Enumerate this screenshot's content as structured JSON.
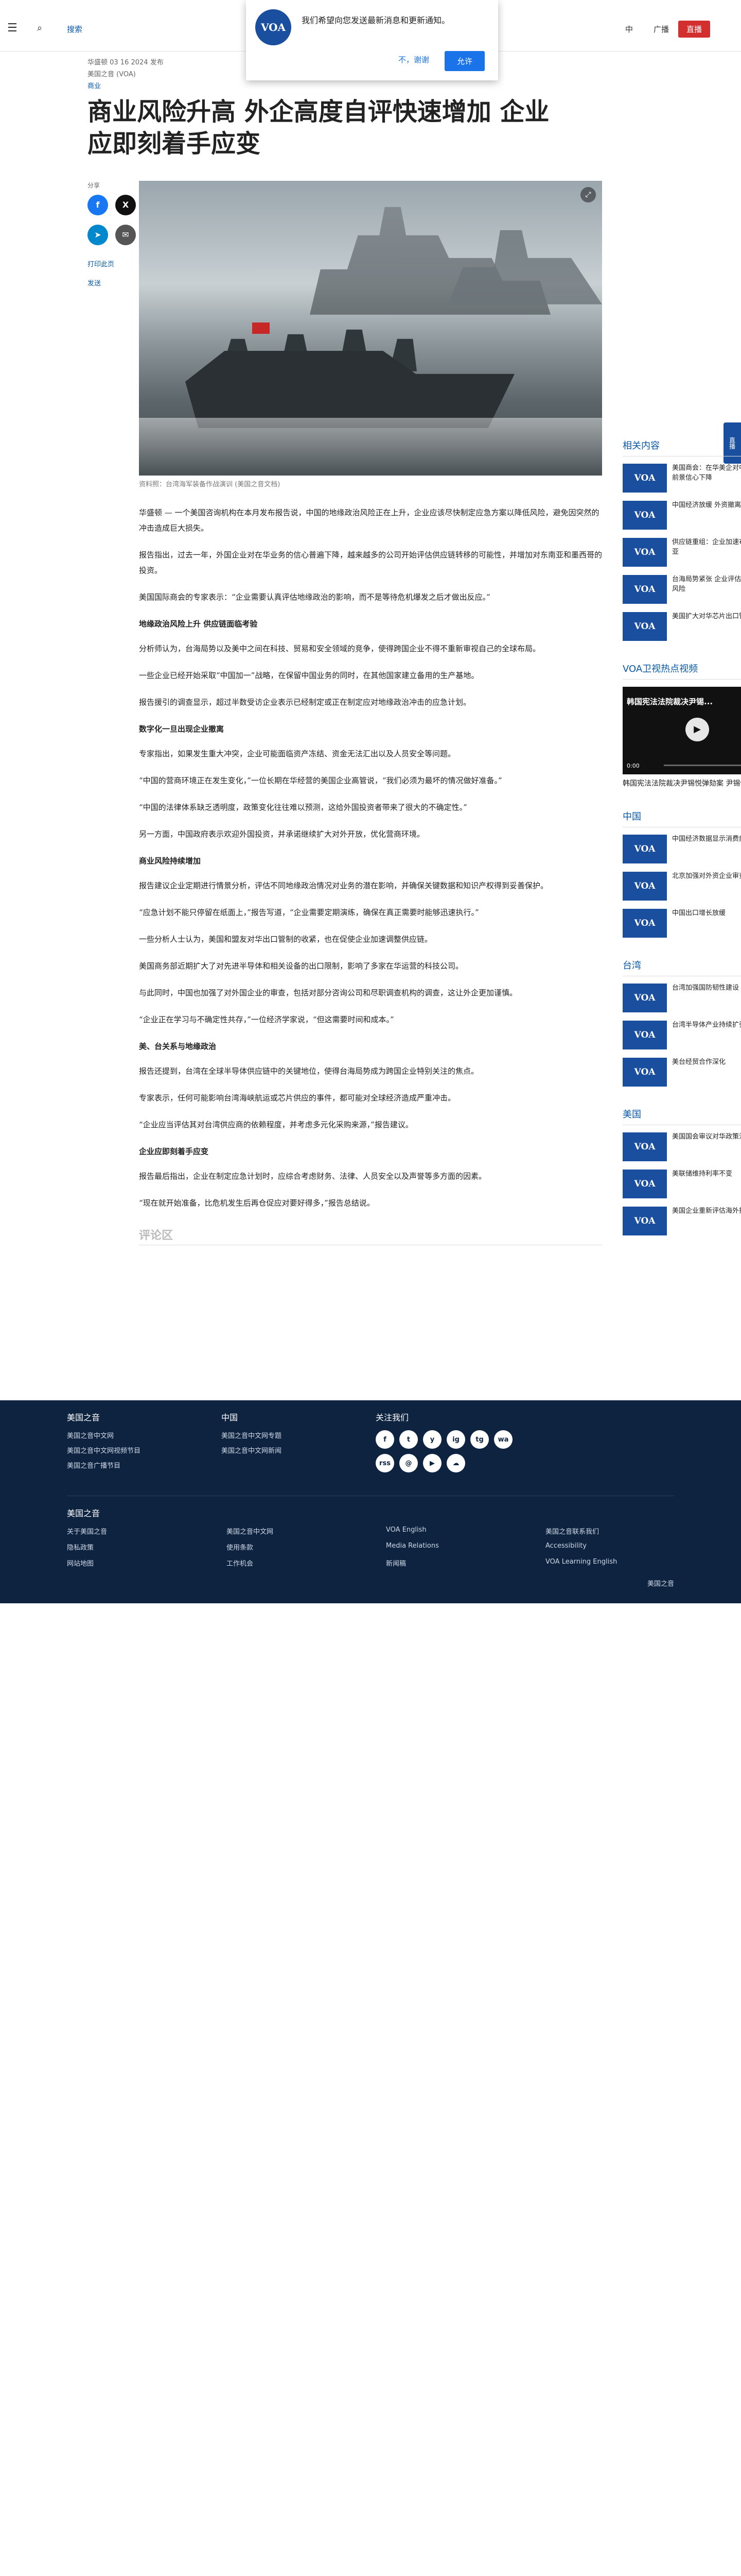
{
  "header": {
    "search_label": "搜索",
    "lang": "中",
    "radio": "广播",
    "live": "直播"
  },
  "notify": {
    "logo": "VOA",
    "text": "我们希望向您发送最新消息和更新通知。",
    "no": "不，谢谢",
    "yes": "允许"
  },
  "meta": {
    "date": "华盛顿 03 16 2024 发布",
    "author": "美国之音 (VOA)",
    "category": "商业"
  },
  "title": "商业风险升高 外企高度自评快速增加 企业应即刻着手应变",
  "share": {
    "label": "分享",
    "print": "打印此页",
    "email": "发送"
  },
  "hero": {
    "caption": "资料照：台湾海军装备作战演训 (美国之音文档)"
  },
  "body": [
    {
      "type": "p",
      "text": "华盛顿 — 一个美国咨询机构在本月发布报告说，中国的地缘政治风险正在上升，企业应该尽快制定应急方案以降低风险，避免因突然的冲击造成巨大损失。"
    },
    {
      "type": "p",
      "text": "报告指出，过去一年，外国企业对在华业务的信心普遍下降，越来越多的公司开始评估供应链转移的可能性，并增加对东南亚和墨西哥的投资。"
    },
    {
      "type": "p",
      "text": "美国国际商会的专家表示：“企业需要认真评估地缘政治的影响，而不是等待危机爆发之后才做出反应。”"
    },
    {
      "type": "h3",
      "text": "地缘政治风险上升 供应链面临考验"
    },
    {
      "type": "p",
      "text": "分析师认为，台海局势以及美中之间在科技、贸易和安全领域的竞争，使得跨国企业不得不重新审视自己的全球布局。"
    },
    {
      "type": "p",
      "text": "一些企业已经开始采取“中国加一”战略，在保留中国业务的同时，在其他国家建立备用的生产基地。"
    },
    {
      "type": "p",
      "text": "报告援引的调查显示，超过半数受访企业表示已经制定或正在制定应对地缘政治冲击的应急计划。"
    },
    {
      "type": "h3",
      "text": "数字化一旦出现企业撤离"
    },
    {
      "type": "p",
      "text": "专家指出，如果发生重大冲突，企业可能面临资产冻结、资金无法汇出以及人员安全等问题。"
    },
    {
      "type": "p",
      "text": "“中国的营商环境正在发生变化，”一位长期在华经营的美国企业高管说，“我们必须为最坏的情况做好准备。”"
    },
    {
      "type": "p",
      "text": "“中国的法律体系缺乏透明度，政策变化往往难以预测，这给外国投资者带来了很大的不确定性。”"
    },
    {
      "type": "p",
      "text": "另一方面，中国政府表示欢迎外国投资，并承诺继续扩大对外开放，优化营商环境。"
    },
    {
      "type": "h3",
      "text": "商业风险持续增加"
    },
    {
      "type": "p",
      "text": "报告建议企业定期进行情景分析，评估不同地缘政治情况对业务的潜在影响，并确保关键数据和知识产权得到妥善保护。"
    },
    {
      "type": "p",
      "text": "“应急计划不能只停留在纸面上，”报告写道，“企业需要定期演练，确保在真正需要时能够迅速执行。”"
    },
    {
      "type": "p",
      "text": "一些分析人士认为，美国和盟友对华出口管制的收紧，也在促使企业加速调整供应链。"
    },
    {
      "type": "p",
      "text": "美国商务部近期扩大了对先进半导体和相关设备的出口限制，影响了多家在华运营的科技公司。"
    },
    {
      "type": "p",
      "text": "与此同时，中国也加强了对外国企业的审查，包括对部分咨询公司和尽职调查机构的调查，这让外企更加谨慎。"
    },
    {
      "type": "p",
      "text": "“企业正在学习与不确定性共存，”一位经济学家说，“但这需要时间和成本。”"
    },
    {
      "type": "h3",
      "text": "美、台关系与地缘政治"
    },
    {
      "type": "p",
      "text": "报告还提到，台湾在全球半导体供应链中的关键地位，使得台海局势成为跨国企业特别关注的焦点。"
    },
    {
      "type": "p",
      "text": "专家表示，任何可能影响台湾海峡航运或芯片供应的事件，都可能对全球经济造成严重冲击。"
    },
    {
      "type": "p",
      "text": "“企业应当评估其对台湾供应商的依赖程度，并考虑多元化采购来源，”报告建议。"
    },
    {
      "type": "h3",
      "text": "企业应即刻着手应变"
    },
    {
      "type": "p",
      "text": "报告最后指出，企业在制定应急计划时，应综合考虑财务、法律、人员安全以及声誉等多方面的因素。"
    },
    {
      "type": "p",
      "text": "“现在就开始准备，比危机发生后再仓促应对要好得多，”报告总结说。"
    }
  ],
  "comments_label": "评论区",
  "sidebar": {
    "section1": {
      "title": "相关内容",
      "items": [
        {
          "thumb": "VOA",
          "text": "美国商会：在华美企对中国经济前景信心下降"
        },
        {
          "thumb": "VOA",
          "text": "中国经济放缓 外资撤离速度加快"
        },
        {
          "thumb": "VOA",
          "text": "供应链重组：企业加速布局东南亚"
        },
        {
          "thumb": "VOA",
          "text": "台海局势紧张 企业评估地缘政治风险"
        },
        {
          "thumb": "VOA",
          "text": "美国扩大对华芯片出口管制"
        }
      ]
    },
    "video": {
      "title": "VOA卫视热点视频",
      "video_title": "韩国宪法法院裁决尹锡...",
      "time": "0:00",
      "caption": "韩国宪法法院裁决尹锡悦弹劾案 尹锡悦被罢免"
    },
    "section2": {
      "title": "中国",
      "items": [
        {
          "thumb": "VOA",
          "text": "中国经济数据显示消费疲软"
        },
        {
          "thumb": "VOA",
          "text": "北京加强对外资企业审查"
        },
        {
          "thumb": "VOA",
          "text": "中国出口增长放缓"
        }
      ]
    },
    "section3": {
      "title": "台湾",
      "items": [
        {
          "thumb": "VOA",
          "text": "台湾加强国防韧性建设"
        },
        {
          "thumb": "VOA",
          "text": "台湾半导体产业持续扩张"
        },
        {
          "thumb": "VOA",
          "text": "美台经贸合作深化"
        }
      ]
    },
    "section4": {
      "title": "美国",
      "items": [
        {
          "thumb": "VOA",
          "text": "美国国会审议对华政策法案"
        },
        {
          "thumb": "VOA",
          "text": "美联储维持利率不变"
        },
        {
          "thumb": "VOA",
          "text": "美国企业重新评估海外投资"
        }
      ]
    }
  },
  "side_tab": "直播",
  "footer": {
    "col1": {
      "title": "美国之音",
      "items": [
        "美国之音中文网",
        "美国之音中文网视频节目",
        "美国之音广播节目"
      ]
    },
    "col2": {
      "title": "中国",
      "items": [
        "美国之音中文网专题",
        "美国之音中文网新闻"
      ]
    },
    "col3": {
      "title": "关注我们",
      "social": [
        "f",
        "t",
        "y",
        "ig",
        "tg",
        "wa",
        "rss",
        "@",
        "▶",
        "☁"
      ]
    },
    "sec2_title": "美国之音",
    "links": [
      "关于美国之音",
      "美国之音中文网",
      "VOA English",
      "美国之音联系我们",
      "隐私政策",
      "使用条款",
      "Media Relations",
      "Accessibility",
      "网站地图",
      "工作机会",
      "新闻稿",
      "VOA Learning English"
    ],
    "bottom": "美国之音"
  }
}
